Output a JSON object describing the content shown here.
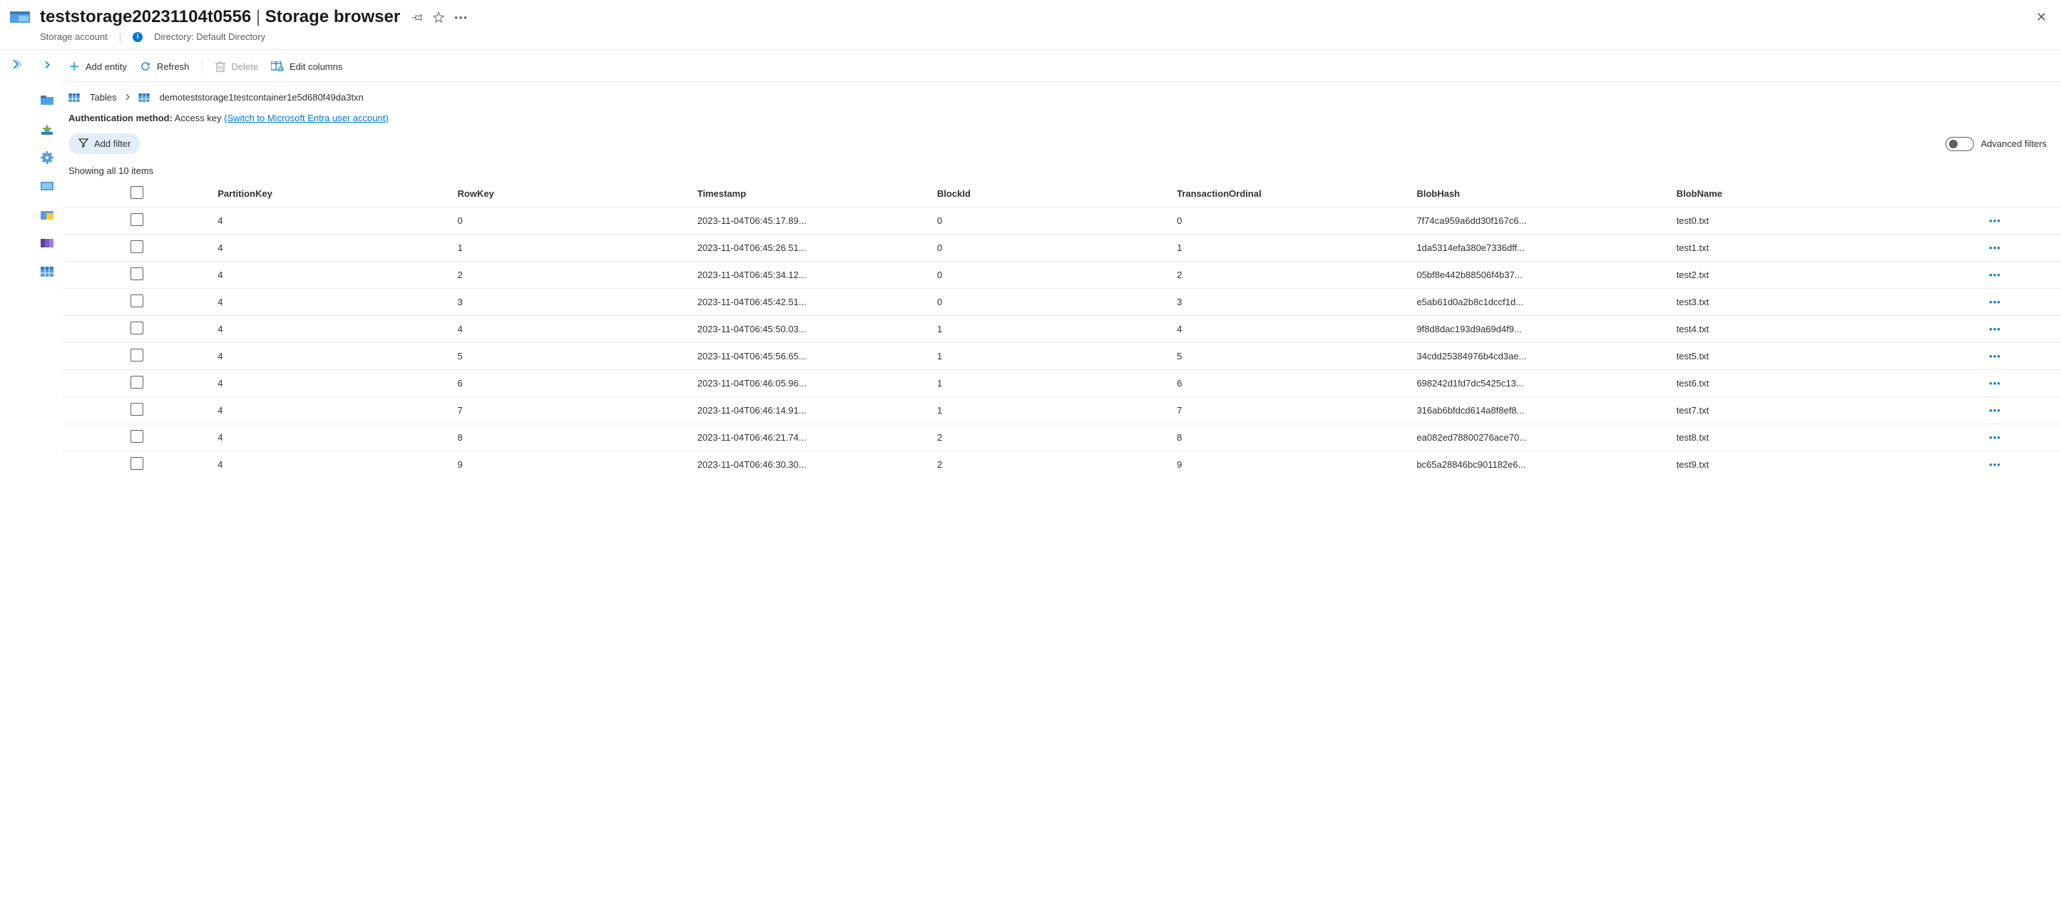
{
  "header": {
    "storage_name": "teststorage20231104t0556",
    "section": "Storage browser",
    "resource_type": "Storage account",
    "directory_label": "Directory: Default Directory"
  },
  "toolbar": {
    "add_entity": "Add entity",
    "refresh": "Refresh",
    "delete": "Delete",
    "edit_columns": "Edit columns"
  },
  "breadcrumb": {
    "tables": "Tables",
    "current": "demoteststorage1testcontainer1e5d680f49da3txn"
  },
  "auth": {
    "label": "Authentication method:",
    "method": "Access key",
    "switch_link": "(Switch to Microsoft Entra user account)"
  },
  "filters": {
    "add_filter": "Add filter",
    "advanced": "Advanced filters"
  },
  "count_text": "Showing all 10 items",
  "columns": [
    "PartitionKey",
    "RowKey",
    "Timestamp",
    "BlockId",
    "TransactionOrdinal",
    "BlobHash",
    "BlobName"
  ],
  "rows": [
    {
      "PartitionKey": "4",
      "RowKey": "0",
      "Timestamp": "2023-11-04T06:45:17.89...",
      "BlockId": "0",
      "TransactionOrdinal": "0",
      "BlobHash": "7f74ca959a6dd30f167c6...",
      "BlobName": "test0.txt"
    },
    {
      "PartitionKey": "4",
      "RowKey": "1",
      "Timestamp": "2023-11-04T06:45:26.51...",
      "BlockId": "0",
      "TransactionOrdinal": "1",
      "BlobHash": "1da5314efa380e7336dff...",
      "BlobName": "test1.txt"
    },
    {
      "PartitionKey": "4",
      "RowKey": "2",
      "Timestamp": "2023-11-04T06:45:34.12...",
      "BlockId": "0",
      "TransactionOrdinal": "2",
      "BlobHash": "05bf8e442b88506f4b37...",
      "BlobName": "test2.txt"
    },
    {
      "PartitionKey": "4",
      "RowKey": "3",
      "Timestamp": "2023-11-04T06:45:42.51...",
      "BlockId": "0",
      "TransactionOrdinal": "3",
      "BlobHash": "e5ab61d0a2b8c1dccf1d...",
      "BlobName": "test3.txt"
    },
    {
      "PartitionKey": "4",
      "RowKey": "4",
      "Timestamp": "2023-11-04T06:45:50.03...",
      "BlockId": "1",
      "TransactionOrdinal": "4",
      "BlobHash": "9f8d8dac193d9a69d4f9...",
      "BlobName": "test4.txt"
    },
    {
      "PartitionKey": "4",
      "RowKey": "5",
      "Timestamp": "2023-11-04T06:45:56.65...",
      "BlockId": "1",
      "TransactionOrdinal": "5",
      "BlobHash": "34cdd25384976b4cd3ae...",
      "BlobName": "test5.txt"
    },
    {
      "PartitionKey": "4",
      "RowKey": "6",
      "Timestamp": "2023-11-04T06:46:05.96...",
      "BlockId": "1",
      "TransactionOrdinal": "6",
      "BlobHash": "698242d1fd7dc5425c13...",
      "BlobName": "test6.txt"
    },
    {
      "PartitionKey": "4",
      "RowKey": "7",
      "Timestamp": "2023-11-04T06:46:14.91...",
      "BlockId": "1",
      "TransactionOrdinal": "7",
      "BlobHash": "316ab6bfdcd614a8f8ef8...",
      "BlobName": "test7.txt"
    },
    {
      "PartitionKey": "4",
      "RowKey": "8",
      "Timestamp": "2023-11-04T06:46:21.74...",
      "BlockId": "2",
      "TransactionOrdinal": "8",
      "BlobHash": "ea082ed78800276ace70...",
      "BlobName": "test8.txt"
    },
    {
      "PartitionKey": "4",
      "RowKey": "9",
      "Timestamp": "2023-11-04T06:46:30.30...",
      "BlockId": "2",
      "TransactionOrdinal": "9",
      "BlobHash": "bc65a28846bc901182e6...",
      "BlobName": "test9.txt"
    }
  ]
}
